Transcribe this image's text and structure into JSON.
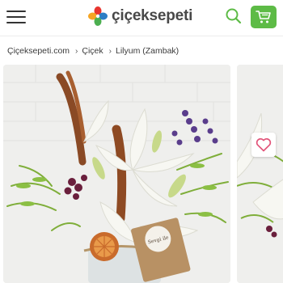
{
  "header": {
    "menu_icon": "hamburger-menu-icon",
    "logo_text": "çiçeksepeti",
    "search_icon": "search-icon",
    "cart_icon": "shopping-cart-icon",
    "cart_color": "#5dbb46"
  },
  "breadcrumb": [
    {
      "label": "Çiçeksepeti.com"
    },
    {
      "label": "Çiçek"
    },
    {
      "label": "Lilyum (Zambak)"
    }
  ],
  "gallery": {
    "favorite_icon": "heart-icon",
    "favorite_color": "#e2557a",
    "tag_text": "Sevgi ile"
  }
}
